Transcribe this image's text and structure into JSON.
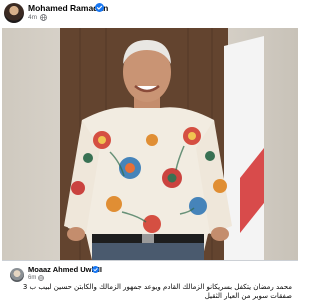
{
  "post": {
    "author": "Mohamed Ramadan",
    "time": "4m",
    "verified": true,
    "icons": {
      "verified": "verified-badge-icon",
      "audience": "globe-icon"
    }
  },
  "comment": {
    "author": "Moaaz Ahmed Uwk II",
    "time": "6m",
    "verified": true,
    "text": "محمد رمضان يتكفل بسريكانو الزمالك القادم ويوعد جمهور الزمالك والكابتن حسين لبيب ب 3 صفقات سوبر من العيار الثقيل"
  },
  "colors": {
    "verified_blue": "#1877f2",
    "meta_gray": "#65676b",
    "text": "#050505",
    "divider": "#ccd0d5"
  }
}
